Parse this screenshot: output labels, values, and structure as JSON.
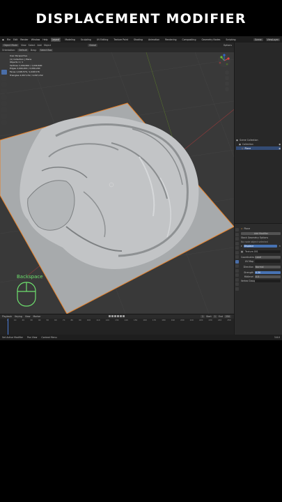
{
  "caption": "DISPLACEMENT MODIFIER",
  "menubar": {
    "menus": [
      "File",
      "Edit",
      "Render",
      "Window",
      "Help"
    ],
    "workspaces": [
      {
        "label": "Layout",
        "active": true
      },
      {
        "label": "Modeling",
        "active": false
      },
      {
        "label": "Sculpting",
        "active": false
      },
      {
        "label": "UV Editing",
        "active": false
      },
      {
        "label": "Texture Paint",
        "active": false
      },
      {
        "label": "Shading",
        "active": false
      },
      {
        "label": "Animation",
        "active": false
      },
      {
        "label": "Rendering",
        "active": false
      },
      {
        "label": "Compositing",
        "active": false
      },
      {
        "label": "Geometry Nodes",
        "active": false
      },
      {
        "label": "Scripting",
        "active": false
      }
    ],
    "scene": "Scene",
    "view_layer": "ViewLayer"
  },
  "header": {
    "mode": "Object Mode",
    "menus": [
      "View",
      "Select",
      "Add",
      "Object"
    ],
    "transform": "Global",
    "options": "Options"
  },
  "header2": {
    "orientation_label": "Orientation:",
    "orientation_value": "Default",
    "drag_label": "Drag:",
    "drag_value": "Select Box"
  },
  "viewport": {
    "view_name": "User Perspective",
    "collection_line": "(1) Collection | Plane",
    "stats": [
      {
        "label": "Objects",
        "value": "1 / 1"
      },
      {
        "label": "Vertices",
        "value": "1,049,600 / 1,049,600"
      },
      {
        "label": "Edges",
        "value": "2,099,200 / 2,099,200"
      },
      {
        "label": "Faces",
        "value": "1,048,576 / 1,048,576"
      },
      {
        "label": "Triangles",
        "value": "2,097,152 / 2,097,152"
      }
    ],
    "key_overlay": "Backspace",
    "colors": {
      "plane": "#a7aaac",
      "relief": "#c2c4c6",
      "outline": "#e8822a",
      "grid": "#3a3a3a"
    }
  },
  "outliner": {
    "search_label": "Scene Collection",
    "items": [
      {
        "label": "Scene Collection",
        "selected": false
      },
      {
        "label": "Collection",
        "selected": false
      },
      {
        "label": "Plane",
        "selected": true
      }
    ]
  },
  "properties": {
    "object_name": "Plane",
    "modifier_name": "Displace",
    "add_modifier": "Add Modifier",
    "stack_label": "Stack Geometry Options",
    "no_node_group": "No node object selected",
    "texture_name": "Texture.001",
    "fields": [
      {
        "label": "Coordinates",
        "value": "Local"
      },
      {
        "label": "UV Map",
        "value": ""
      },
      {
        "label": "Direction",
        "value": "Normal"
      },
      {
        "label": "Strength",
        "value": "0.30"
      },
      {
        "label": "Midlevel",
        "value": "0.5"
      },
      {
        "label": "Vertex Group",
        "value": ""
      }
    ]
  },
  "timeline": {
    "menus": [
      "Playback",
      "Keying",
      "View",
      "Marker"
    ],
    "ticks": [
      "0",
      "10",
      "20",
      "30",
      "40",
      "50",
      "60",
      "70",
      "80",
      "90",
      "100",
      "110",
      "120",
      "130",
      "140",
      "150",
      "160",
      "170",
      "180",
      "190",
      "200",
      "210",
      "220",
      "230",
      "240",
      "250"
    ],
    "current_frame": "1",
    "start_label": "Start",
    "start_value": "1",
    "end_label": "End",
    "end_value": "250"
  },
  "statusbar": {
    "items": [
      "Set Active Modifier",
      "Pan View",
      "Context Menu"
    ],
    "version": "3.6.0"
  }
}
